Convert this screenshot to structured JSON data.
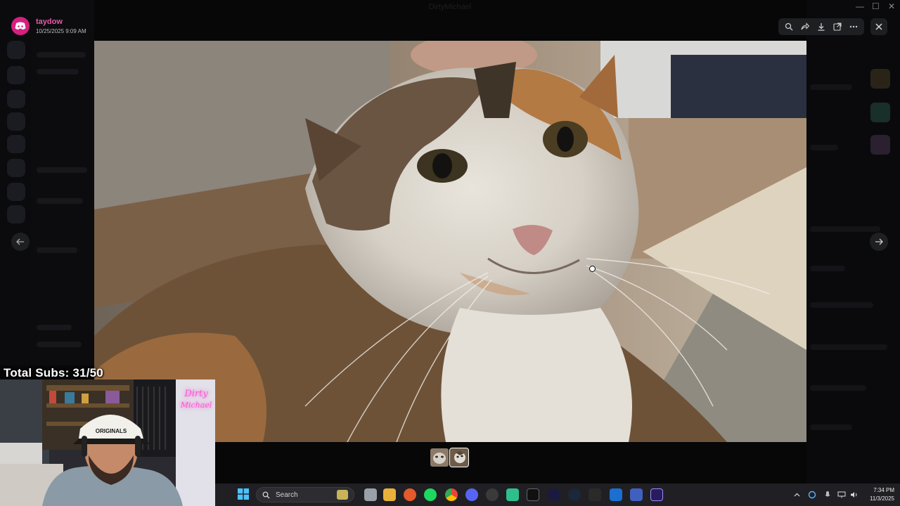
{
  "window": {
    "title": "DirtyMichael"
  },
  "viewer": {
    "username": "taydow",
    "timestamp": "10/25/2025 9:09 AM",
    "toolbar_icons": [
      "zoom-icon",
      "share-forward-icon",
      "download-icon",
      "open-external-icon",
      "more-icon"
    ],
    "close_icon": "close-icon",
    "thumbnail_count": 2
  },
  "stream_overlay": {
    "subs_text": "Total Subs: 31/50"
  },
  "taskbar": {
    "search_label": "Search",
    "clock_time": "7:34 PM",
    "clock_date": "11/3/2025"
  },
  "colors": {
    "discord": "#d5207f",
    "username": "#e75aa6",
    "taskbar": "#202024",
    "toolbar": "#1e1f22"
  }
}
